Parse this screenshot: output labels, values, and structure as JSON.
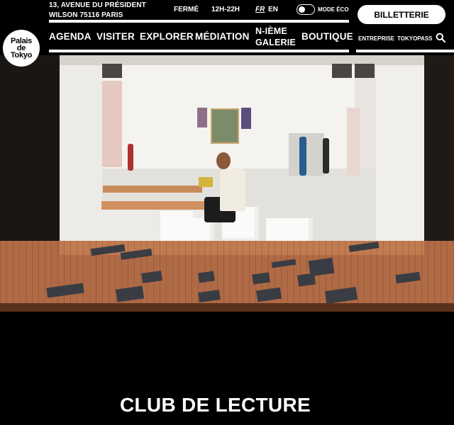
{
  "header": {
    "logo": "Palais de Tokyo",
    "address_line1": "13, AVENUE DU PRÉSIDENT",
    "address_line2": "WILSON 75116 PARIS",
    "status": "FERMÉ",
    "hours": "12H-22H",
    "lang_active": "FR",
    "lang_other": "EN",
    "eco_mode_label": "MODE ÉCO",
    "ticket_button": "BILLETTERIE"
  },
  "nav": {
    "agenda": "AGENDA",
    "visiter": "VISITER",
    "explorer": "EXPLORER",
    "mediation": "MÉDIATION",
    "galerie_line1": "N-IÈME",
    "galerie_line2": "GALERIE",
    "boutique": "BOUTIQUE"
  },
  "utility": {
    "entreprise": "ENTREPRISE",
    "tokyopass": "TOKYOPASS",
    "search_icon": "search-icon"
  },
  "page": {
    "title": "CLUB DE LECTURE"
  },
  "colors": {
    "background": "#000000",
    "text": "#ffffff",
    "stage_wood": "#b06a45"
  }
}
